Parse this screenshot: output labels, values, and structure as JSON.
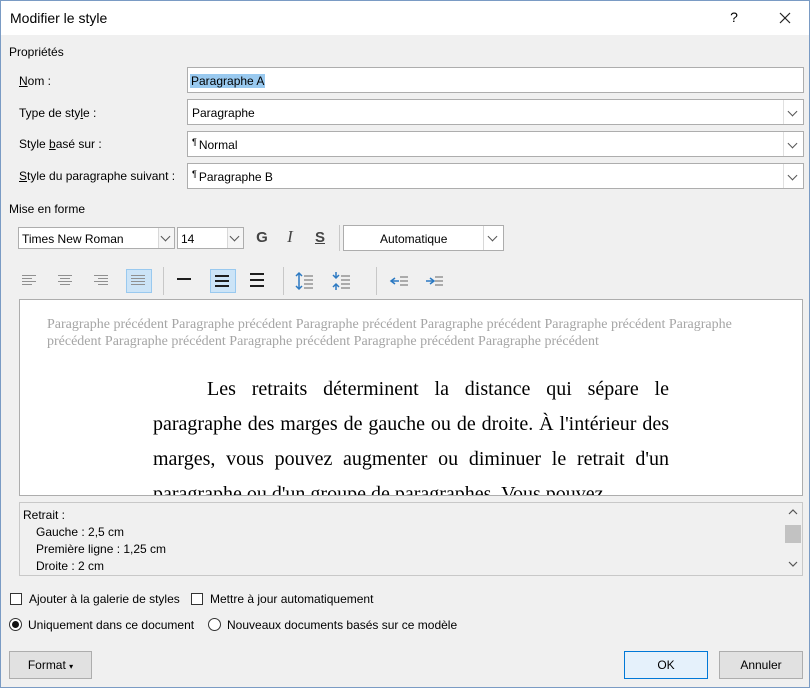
{
  "window": {
    "title": "Modifier le style",
    "help": "?",
    "close": "✕"
  },
  "properties": {
    "section_title": "Propriétés",
    "name_label": "Nom :",
    "name_value": "Paragraphe A",
    "style_type_label": "Type de style :",
    "style_type_value": "Paragraphe",
    "based_on_label": "Style basé sur :",
    "based_on_value": "Normal",
    "next_style_label": "Style du paragraphe suivant :",
    "next_style_value": "Paragraphe B"
  },
  "formatting": {
    "section_title": "Mise en forme",
    "font": "Times New Roman",
    "size": "14",
    "bold": "G",
    "italic": "I",
    "underline": "S",
    "color": "Automatique"
  },
  "preview": {
    "previous_text": "Paragraphe précédent Paragraphe précédent Paragraphe précédent Paragraphe précédent Paragraphe précédent Paragraphe précédent Paragraphe précédent Paragraphe précédent Paragraphe précédent Paragraphe précédent",
    "sample_text": "Les retraits déterminent la distance qui sépare le paragraphe des marges de gauche ou de droite. À l'intérieur des marges, vous pouvez augmenter ou diminuer le retrait d'un paragraphe ou d'un groupe de paragraphes. Vous pouvez"
  },
  "description": {
    "line1": "Retrait :",
    "line2": "Gauche :  2,5 cm",
    "line3": "Première ligne : 1,25 cm",
    "line4": "Droite :  2 cm"
  },
  "options": {
    "add_gallery": "Ajouter à la galerie de styles",
    "auto_update": "Mettre à jour automatiquement",
    "only_this_doc": "Uniquement dans ce document",
    "new_docs": "Nouveaux documents basés sur ce modèle"
  },
  "buttons": {
    "format": "Format",
    "ok": "OK",
    "cancel": "Annuler"
  },
  "colors": {
    "accent": "#0078d7",
    "selection": "#99c9ef",
    "active_button": "#cce4f7"
  }
}
